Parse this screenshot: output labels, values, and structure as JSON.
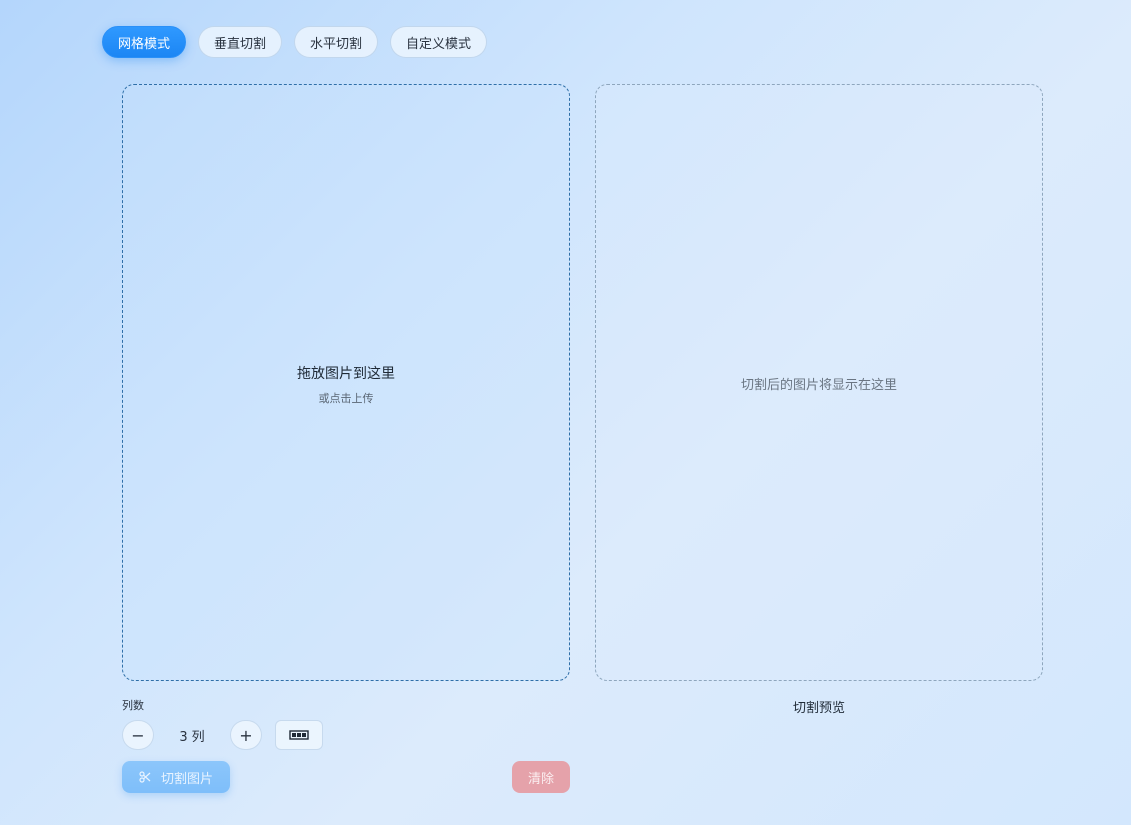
{
  "tabs": [
    {
      "label": "网格模式",
      "active": true
    },
    {
      "label": "垂直切割",
      "active": false
    },
    {
      "label": "水平切割",
      "active": false
    },
    {
      "label": "自定义模式",
      "active": false
    }
  ],
  "upload": {
    "title": "拖放图片到这里",
    "subtitle": "或点击上传"
  },
  "preview": {
    "placeholder": "切割后的图片将显示在这里",
    "label": "切割预览"
  },
  "columns": {
    "label": "列数",
    "value": "3",
    "suffix": "列",
    "minus": "−",
    "plus": "+"
  },
  "actions": {
    "cut_label": "切割图片",
    "clear_label": "清除"
  },
  "icons": {
    "scissors": "scissors-icon",
    "grid_tool": "columns-layout-icon"
  },
  "colors": {
    "accent": "#1c86f4",
    "cut_button": "#84c2fa",
    "clear_button": "#e5a2aa"
  }
}
